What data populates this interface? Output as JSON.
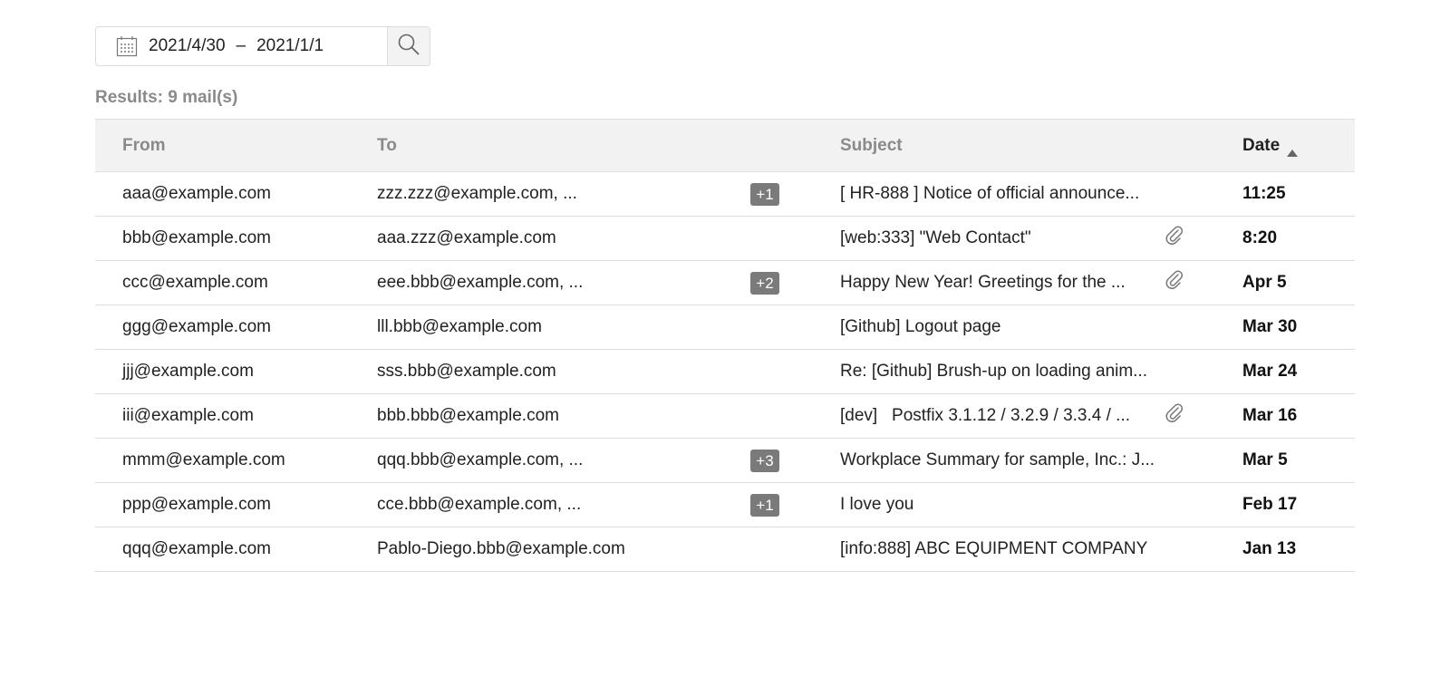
{
  "search": {
    "date_from": "2021/4/30",
    "separator": "–",
    "date_to": "2021/1/1"
  },
  "results_label": "Results: 9 mail(s)",
  "table": {
    "headers": {
      "from": "From",
      "to": "To",
      "subject": "Subject",
      "date": "Date"
    },
    "sort": "ascending",
    "rows": [
      {
        "from": "aaa@example.com",
        "to": "zzz.zzz@example.com, ...",
        "badge": "+1",
        "subject": "[ HR-888 ] Notice of official announce...",
        "attachment": false,
        "date": "11:25"
      },
      {
        "from": "bbb@example.com",
        "to": "aaa.zzz@example.com",
        "badge": "",
        "subject": "[web:333] \"Web Contact\"",
        "attachment": true,
        "date": "8:20"
      },
      {
        "from": "ccc@example.com",
        "to": "eee.bbb@example.com, ...",
        "badge": "+2",
        "subject": "Happy New Year! Greetings for the ...",
        "attachment": true,
        "date": "Apr 5"
      },
      {
        "from": "ggg@example.com",
        "to": "lll.bbb@example.com",
        "badge": "",
        "subject": "[Github] Logout page",
        "attachment": false,
        "date": "Mar 30"
      },
      {
        "from": "jjj@example.com",
        "to": "sss.bbb@example.com",
        "badge": "",
        "subject": "Re: [Github] Brush-up on loading anim...",
        "attachment": false,
        "date": "Mar 24"
      },
      {
        "from": "iii@example.com",
        "to": "bbb.bbb@example.com",
        "badge": "",
        "subject": "[dev]   Postfix 3.1.12 / 3.2.9 / 3.3.4 / ...",
        "attachment": true,
        "date": "Mar 16"
      },
      {
        "from": "mmm@example.com",
        "to": "qqq.bbb@example.com, ...",
        "badge": "+3",
        "subject": "Workplace Summary for sample, Inc.: J...",
        "attachment": false,
        "date": "Mar 5"
      },
      {
        "from": "ppp@example.com",
        "to": "cce.bbb@example.com, ...",
        "badge": "+1",
        "subject": "I love you",
        "attachment": false,
        "date": "Feb 17"
      },
      {
        "from": "qqq@example.com",
        "to": "Pablo-Diego.bbb@example.com",
        "badge": "",
        "subject": "[info:888] ABC EQUIPMENT COMPANY",
        "attachment": false,
        "date": "Jan 13"
      }
    ]
  },
  "icons": {
    "calendar": "calendar-icon",
    "search": "search-icon",
    "sort": "sort-ascending-icon",
    "attachment": "paperclip-icon"
  }
}
